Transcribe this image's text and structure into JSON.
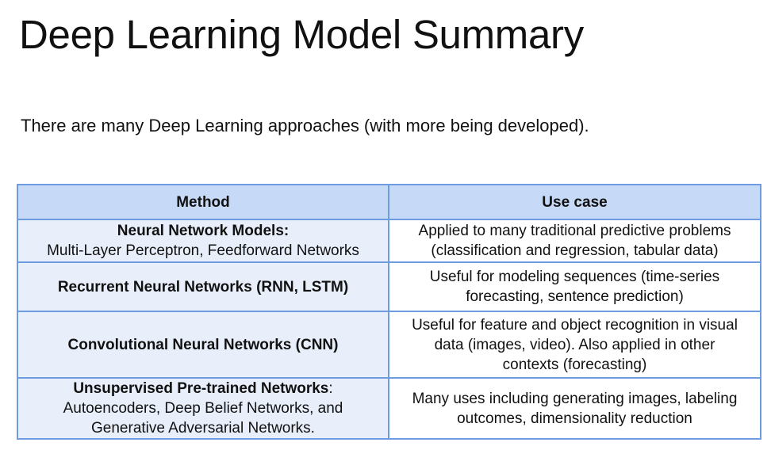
{
  "title": "Deep Learning Model Summary",
  "subtitle": "There are many Deep Learning approaches (with more being developed).",
  "table": {
    "headers": [
      "Method",
      "Use case"
    ],
    "rows": [
      {
        "method_bold": "Neural Network Models:",
        "method_rest": "Multi-Layer Perceptron, Feedforward Networks",
        "use_case_lines": [
          "Applied to many traditional predictive problems",
          "(classification and regression, tabular data)"
        ]
      },
      {
        "method_bold": "Recurrent Neural Networks (RNN, LSTM)",
        "use_case_lines": [
          "Useful for modeling sequences (time-series",
          "forecasting, sentence prediction)"
        ]
      },
      {
        "method_bold": "Convolutional Neural Networks (CNN)",
        "use_case_lines": [
          "Useful for feature and object recognition in visual",
          "data (images, video). Also applied in other",
          "contexts (forecasting)"
        ]
      },
      {
        "method_bold": "Unsupervised Pre-trained Networks",
        "method_colon": ":",
        "method_lines": [
          "Autoencoders, Deep Belief Networks, and",
          "Generative Adversarial Networks."
        ],
        "use_case_lines": [
          "Many uses including generating images, labeling",
          "outcomes, dimensionality reduction"
        ]
      }
    ]
  }
}
